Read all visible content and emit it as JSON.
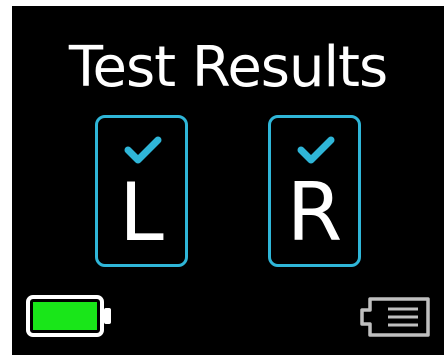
{
  "screen": {
    "title": "Test Results",
    "results": [
      {
        "letter": "L",
        "status": "pass"
      },
      {
        "letter": "R",
        "status": "pass"
      }
    ]
  },
  "status_bar": {
    "battery": {
      "icon": "battery-icon",
      "level": 1.0,
      "color": "#19e619"
    },
    "storage": {
      "icon": "sd-card-icon"
    }
  },
  "colors": {
    "background": "#000000",
    "text": "#ffffff",
    "accent": "#2fb6d8"
  }
}
